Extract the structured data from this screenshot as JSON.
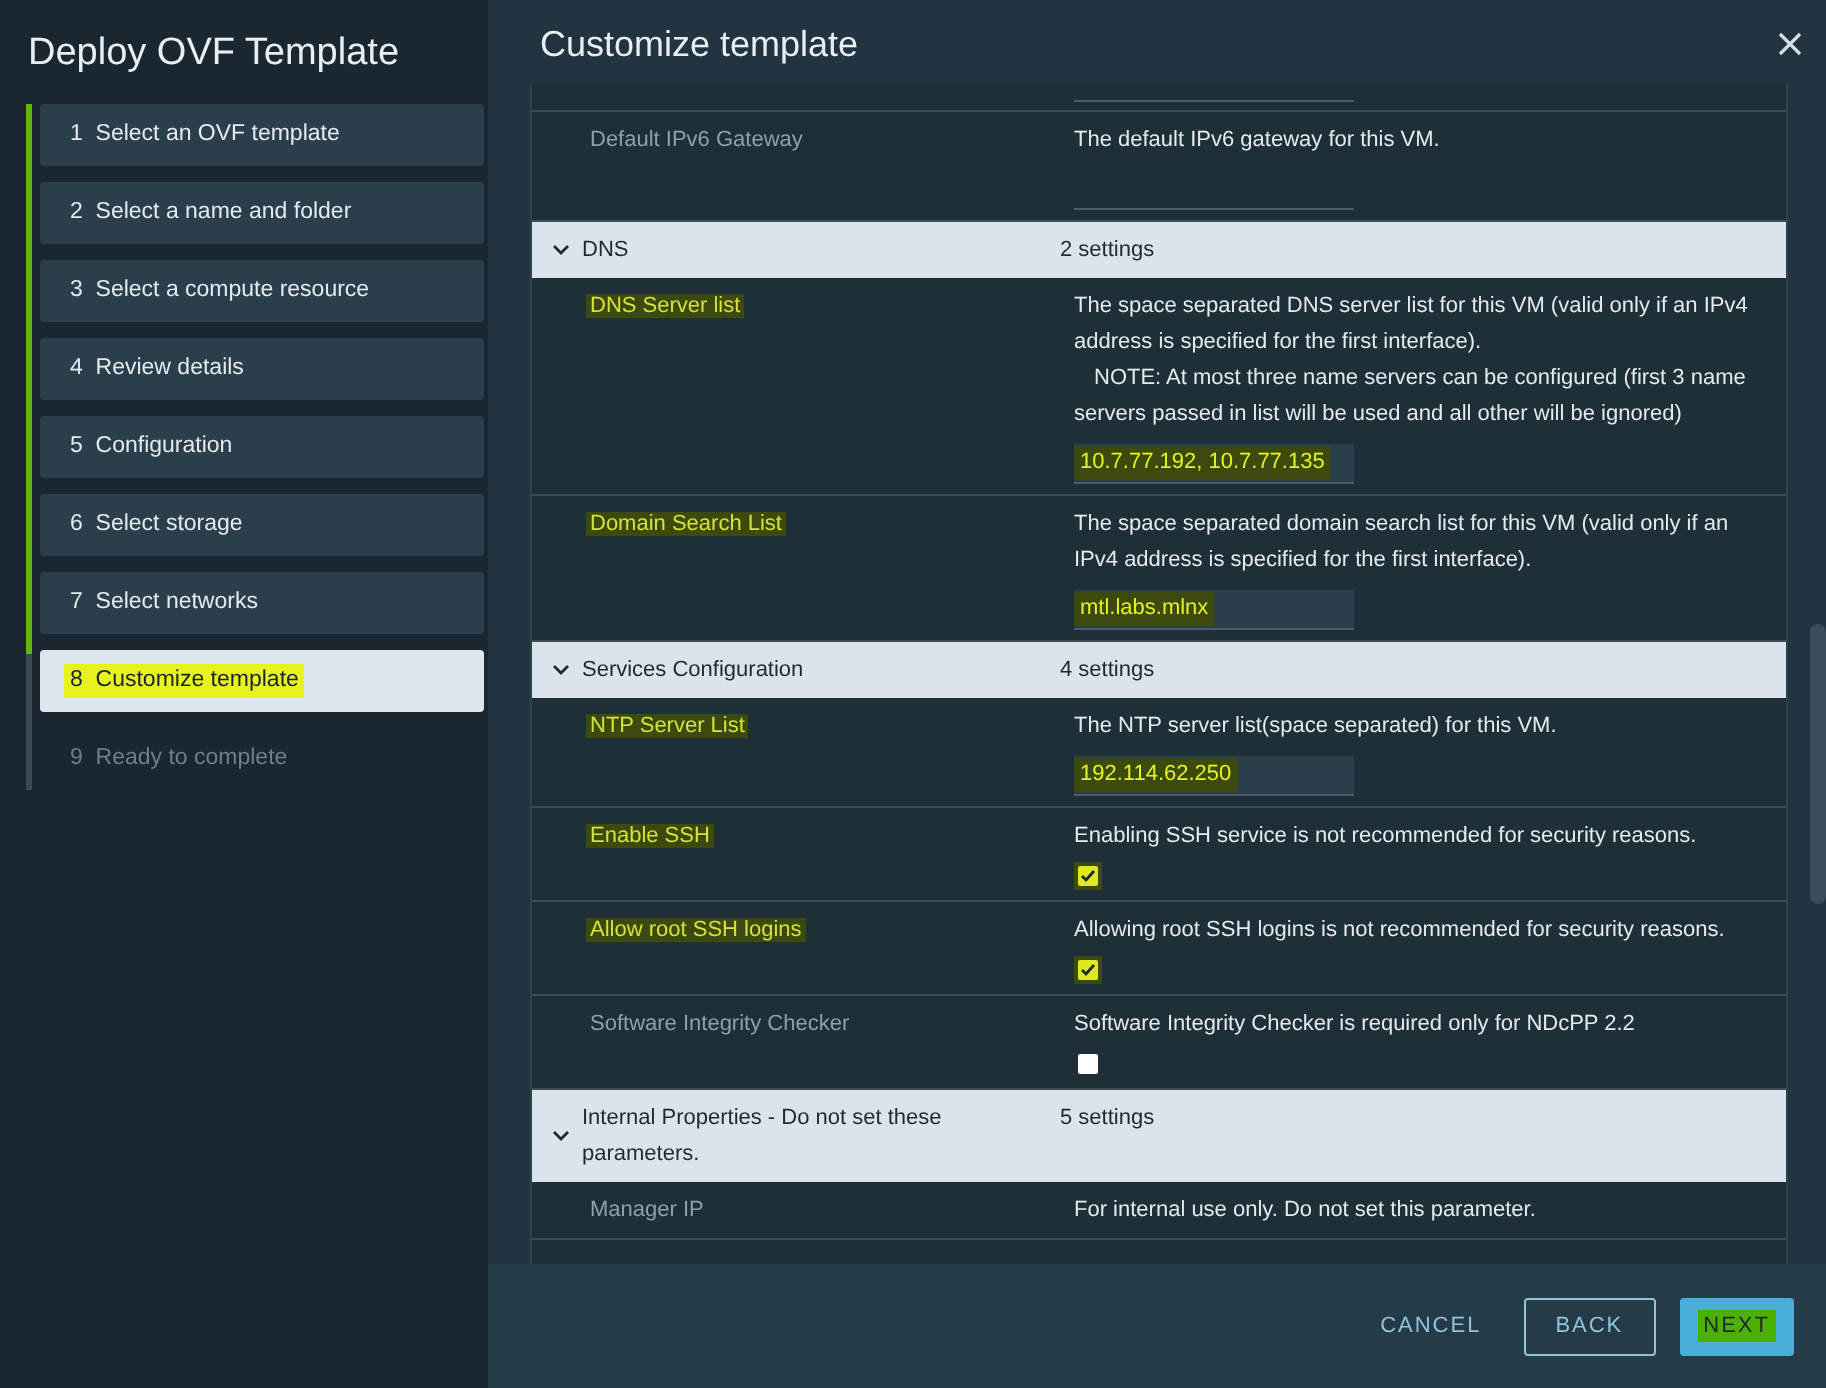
{
  "dialog": {
    "title": "Deploy OVF Template"
  },
  "steps": [
    {
      "number": "1",
      "label": "Select an OVF template",
      "completed": true,
      "selected": false,
      "highlighted": false
    },
    {
      "number": "2",
      "label": "Select a name and folder",
      "completed": true,
      "selected": false,
      "highlighted": false
    },
    {
      "number": "3",
      "label": "Select a compute resource",
      "completed": true,
      "selected": false,
      "highlighted": false
    },
    {
      "number": "4",
      "label": "Review details",
      "completed": true,
      "selected": false,
      "highlighted": false
    },
    {
      "number": "5",
      "label": "Configuration",
      "completed": true,
      "selected": false,
      "highlighted": false
    },
    {
      "number": "6",
      "label": "Select storage",
      "completed": true,
      "selected": false,
      "highlighted": false
    },
    {
      "number": "7",
      "label": "Select networks",
      "completed": true,
      "selected": false,
      "highlighted": false
    },
    {
      "number": "8",
      "label": "Customize template",
      "completed": false,
      "selected": true,
      "highlighted": true
    },
    {
      "number": "9",
      "label": "Ready to complete",
      "completed": false,
      "selected": false,
      "highlighted": false
    }
  ],
  "panel": {
    "title": "Customize template"
  },
  "rows": [
    {
      "kind": "stub"
    },
    {
      "kind": "text",
      "label": "Default IPv6 Gateway",
      "description": "The default IPv6 gateway for this VM.",
      "value": "",
      "highlighted": false
    },
    {
      "kind": "group",
      "label": "DNS",
      "count": "2 settings",
      "expanded": true
    },
    {
      "kind": "text",
      "label": "DNS Server list",
      "description": "The space separated DNS server list for this VM (valid only if an IPv4 address is specified for the first interface).",
      "note": "NOTE: At most three name servers can be configured (first 3 name servers passed in list will be used and all other will be ignored)",
      "value": "10.7.77.192, 10.7.77.135",
      "highlighted": true
    },
    {
      "kind": "text",
      "label": "Domain Search List",
      "description": "The space separated domain search list for this VM (valid only if an IPv4 address is specified for the first interface).",
      "value": "mtl.labs.mlnx",
      "highlighted": true
    },
    {
      "kind": "group",
      "label": "Services Configuration",
      "count": "4 settings",
      "expanded": true
    },
    {
      "kind": "text",
      "label": "NTP Server List",
      "description": "The NTP server list(space separated) for this VM.",
      "value": "192.114.62.250",
      "highlighted": true
    },
    {
      "kind": "checkbox",
      "label": "Enable SSH",
      "description": "Enabling SSH service is not recommended for security reasons.",
      "checked": true,
      "highlighted": true
    },
    {
      "kind": "checkbox",
      "label": "Allow root SSH logins",
      "description": "Allowing root SSH logins is not recommended for security reasons.",
      "checked": true,
      "highlighted": true
    },
    {
      "kind": "checkbox",
      "label": "Software Integrity Checker",
      "description": "Software Integrity Checker is required only for NDcPP 2.2",
      "checked": false,
      "highlighted": false
    },
    {
      "kind": "group",
      "label": "Internal Properties - Do not set these parameters.",
      "count": "5 settings",
      "expanded": true
    },
    {
      "kind": "info",
      "label": "Manager IP",
      "description": "For internal use only. Do not set this parameter."
    }
  ],
  "buttons": [
    {
      "label": "CANCEL",
      "kind": "link",
      "highlighted": false
    },
    {
      "label": "BACK",
      "kind": "outline",
      "highlighted": false
    },
    {
      "label": "NEXT",
      "kind": "primary",
      "highlighted": true
    }
  ]
}
